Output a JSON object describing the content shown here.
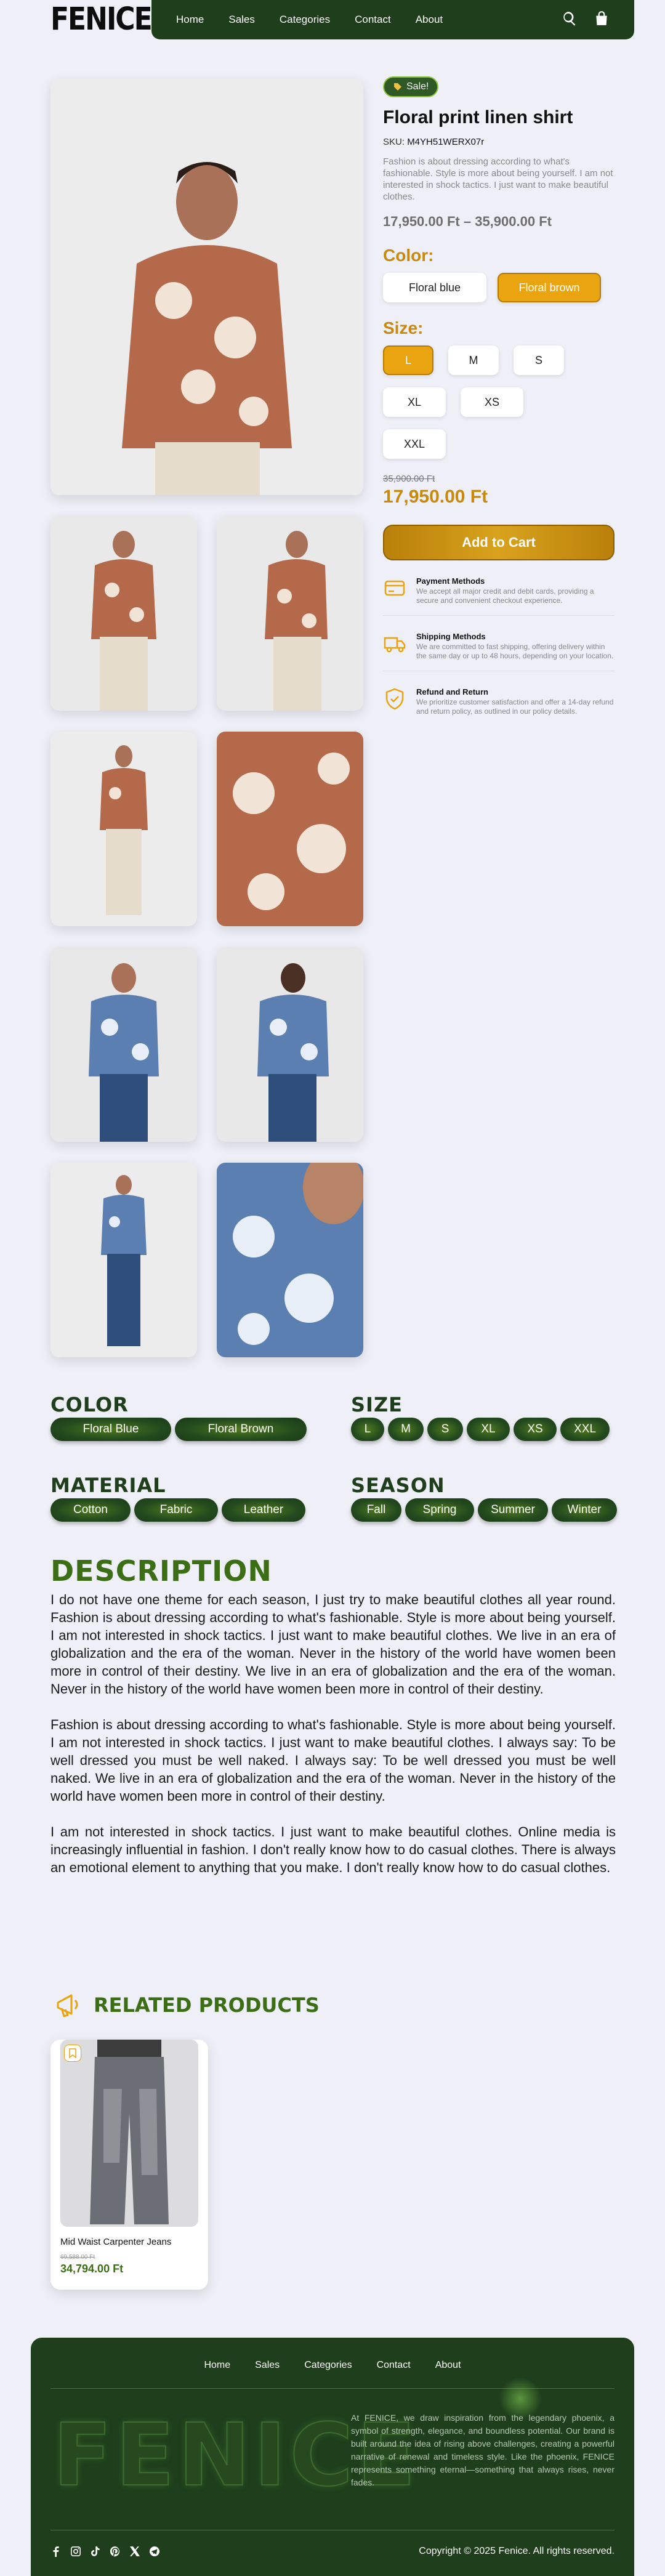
{
  "header": {
    "logo": "FENICE",
    "nav": [
      "Home",
      "Sales",
      "Categories",
      "Contact",
      "About"
    ]
  },
  "product": {
    "badge": "Sale!",
    "title": "Floral print linen shirt",
    "sku_label": "SKU:",
    "sku": "M4YH51WERX07r",
    "description": "Fashion is about dressing according to what's fashionable. Style is more about being yourself. I am not interested in shock tactics. I just want to make beautiful clothes.",
    "price_range": "17,950.00 Ft – 35,900.00 Ft",
    "color_label": "Color:",
    "colors": [
      {
        "label": "Floral blue",
        "active": false
      },
      {
        "label": "Floral brown",
        "active": true
      }
    ],
    "size_label": "Size:",
    "sizes": [
      {
        "label": "L",
        "active": true
      },
      {
        "label": "M",
        "active": false
      },
      {
        "label": "S",
        "active": false
      },
      {
        "label": "XL",
        "active": false
      },
      {
        "label": "XS",
        "active": false
      },
      {
        "label": "XXL",
        "active": false
      }
    ],
    "old_price": "35,900.00 Ft",
    "price": "17,950.00 Ft",
    "add_to_cart": "Add to Cart"
  },
  "features": [
    {
      "icon": "credit-card-icon",
      "title": "Payment Methods",
      "text": "We accept all major credit and debit cards, providing a secure and convenient checkout experience."
    },
    {
      "icon": "truck-icon",
      "title": "Shipping Methods",
      "text": "We are committed to fast shipping, offering delivery within the same day or up to 48 hours, depending on your location."
    },
    {
      "icon": "shield-check-icon",
      "title": "Refund and Return",
      "text": "We prioritize customer satisfaction and offer a 14-day refund and return policy, as outlined in our policy details."
    }
  ],
  "filters": {
    "color": {
      "title": "COLOR",
      "items": [
        "Floral Blue",
        "Floral Brown"
      ]
    },
    "size": {
      "title": "SIZE",
      "items": [
        "L",
        "M",
        "S",
        "XL",
        "XS",
        "XXL"
      ]
    },
    "material": {
      "title": "MATERIAL",
      "items": [
        "Cotton",
        "Fabric",
        "Leather"
      ]
    },
    "season": {
      "title": "SEASON",
      "items": [
        "Fall",
        "Spring",
        "Summer",
        "Winter"
      ]
    }
  },
  "description": {
    "title": "DESCRIPTION",
    "paragraphs": [
      "I do not have one theme for each season, I just try to make beautiful clothes all year round. Fashion is about dressing according to what's fashionable. Style is more about being yourself. I am not interested in shock tactics. I just want to make beautiful clothes. We live in an era of globalization and the era of the woman. Never in the history of the world have women been more in control of their destiny. We live in an era of globalization and the era of the woman. Never in the history of the world have women been more in control of their destiny.",
      "Fashion is about dressing according to what's fashionable. Style is more about being yourself. I am not interested in shock tactics. I just want to make beautiful clothes. I always say: To be well dressed you must be well naked. I always say: To be well dressed you must be well naked. We live in an era of globalization and the era of the woman. Never in the history of the world have women been more in control of their destiny.",
      "I am not interested in shock tactics. I just want to make beautiful clothes. Online media is increasingly influential in fashion. I don't really know how to do casual clothes. There is always an emotional element to anything that you make. I don't really know how to do casual clothes."
    ]
  },
  "related": {
    "title": "RELATED PRODUCTS",
    "items": [
      {
        "name": "Mid Waist Carpenter Jeans",
        "old_price": "69,588.00 Ft",
        "price": "34,794.00 Ft"
      }
    ]
  },
  "footer": {
    "nav": [
      "Home",
      "Sales",
      "Categories",
      "Contact",
      "About"
    ],
    "logo": "FENICE",
    "about": "At FENICE, we draw inspiration from the legendary phoenix, a symbol of strength, elegance, and boundless potential. Our brand is built around the idea of rising above challenges, creating a powerful narrative of renewal and timeless style. Like the phoenix, FENICE represents something eternal—something that always rises, never fades.",
    "social": [
      "facebook-icon",
      "instagram-icon",
      "tiktok-icon",
      "pinterest-icon",
      "x-icon",
      "telegram-icon"
    ],
    "copyright": "Copyright © 2025 Fenice. All rights reserved."
  },
  "colors": {
    "brand_green": "#1e3e1c",
    "accent_gold": "#e9a410",
    "heading_green": "#3c6e15"
  }
}
